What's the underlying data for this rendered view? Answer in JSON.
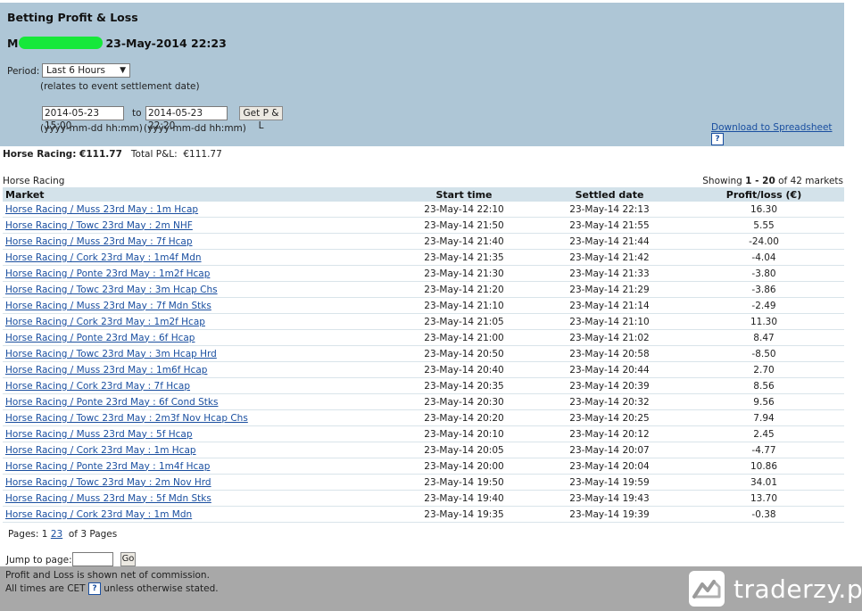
{
  "header": {
    "title": "Betting Profit & Loss",
    "user_initial": "M",
    "datetime": "23-May-2014 22:23",
    "period_label": "Period:",
    "period_value": "Last 6 Hours",
    "period_note": "(relates to event settlement date)",
    "from_date": "2014-05-23 15:00",
    "to_label": "to",
    "to_date": "2014-05-23 22:20",
    "get_button": "Get P & L",
    "format_hint_from": "(yyyy-mm-dd hh:mm)",
    "format_hint_to": "(yyyy-mm-dd hh:mm)",
    "download_link": "Download to Spreadsheet",
    "help_glyph": "?"
  },
  "summary": {
    "category_label": "Horse Racing: €111.77",
    "total_label": "Total P&L:",
    "total_value": "€111.77"
  },
  "section": {
    "name": "Horse Racing",
    "showing_prefix": "Showing",
    "showing_range": "1 - 20",
    "showing_suffix": "of 42 markets"
  },
  "table": {
    "headers": [
      "Market",
      "Start time",
      "Settled date",
      "Profit/loss (€)"
    ],
    "rows": [
      {
        "market": "Horse Racing / Muss 23rd May : 1m Hcap",
        "start": "23-May-14 22:10",
        "settled": "23-May-14 22:13",
        "pl": "16.30"
      },
      {
        "market": "Horse Racing / Towc 23rd May : 2m NHF",
        "start": "23-May-14 21:50",
        "settled": "23-May-14 21:55",
        "pl": "5.55"
      },
      {
        "market": "Horse Racing / Muss 23rd May : 7f Hcap",
        "start": "23-May-14 21:40",
        "settled": "23-May-14 21:44",
        "pl": "-24.00"
      },
      {
        "market": "Horse Racing / Cork 23rd May : 1m4f Mdn",
        "start": "23-May-14 21:35",
        "settled": "23-May-14 21:42",
        "pl": "-4.04"
      },
      {
        "market": "Horse Racing / Ponte 23rd May : 1m2f Hcap",
        "start": "23-May-14 21:30",
        "settled": "23-May-14 21:33",
        "pl": "-3.80"
      },
      {
        "market": "Horse Racing / Towc 23rd May : 3m Hcap Chs",
        "start": "23-May-14 21:20",
        "settled": "23-May-14 21:29",
        "pl": "-3.86"
      },
      {
        "market": "Horse Racing / Muss 23rd May : 7f Mdn Stks",
        "start": "23-May-14 21:10",
        "settled": "23-May-14 21:14",
        "pl": "-2.49"
      },
      {
        "market": "Horse Racing / Cork 23rd May : 1m2f Hcap",
        "start": "23-May-14 21:05",
        "settled": "23-May-14 21:10",
        "pl": "11.30"
      },
      {
        "market": "Horse Racing / Ponte 23rd May : 6f Hcap",
        "start": "23-May-14 21:00",
        "settled": "23-May-14 21:02",
        "pl": "8.47"
      },
      {
        "market": "Horse Racing / Towc 23rd May : 3m Hcap Hrd",
        "start": "23-May-14 20:50",
        "settled": "23-May-14 20:58",
        "pl": "-8.50"
      },
      {
        "market": "Horse Racing / Muss 23rd May : 1m6f Hcap",
        "start": "23-May-14 20:40",
        "settled": "23-May-14 20:44",
        "pl": "2.70"
      },
      {
        "market": "Horse Racing / Cork 23rd May : 7f Hcap",
        "start": "23-May-14 20:35",
        "settled": "23-May-14 20:39",
        "pl": "8.56"
      },
      {
        "market": "Horse Racing / Ponte 23rd May : 6f Cond Stks",
        "start": "23-May-14 20:30",
        "settled": "23-May-14 20:32",
        "pl": "9.56"
      },
      {
        "market": "Horse Racing / Towc 23rd May : 2m3f Nov Hcap Chs",
        "start": "23-May-14 20:20",
        "settled": "23-May-14 20:25",
        "pl": "7.94"
      },
      {
        "market": "Horse Racing / Muss 23rd May : 5f Hcap",
        "start": "23-May-14 20:10",
        "settled": "23-May-14 20:12",
        "pl": "2.45"
      },
      {
        "market": "Horse Racing / Cork 23rd May : 1m Hcap",
        "start": "23-May-14 20:05",
        "settled": "23-May-14 20:07",
        "pl": "-4.77"
      },
      {
        "market": "Horse Racing / Ponte 23rd May : 1m4f Hcap",
        "start": "23-May-14 20:00",
        "settled": "23-May-14 20:04",
        "pl": "10.86"
      },
      {
        "market": "Horse Racing / Towc 23rd May : 2m Nov Hrd",
        "start": "23-May-14 19:50",
        "settled": "23-May-14 19:59",
        "pl": "34.01"
      },
      {
        "market": "Horse Racing / Muss 23rd May : 5f Mdn Stks",
        "start": "23-May-14 19:40",
        "settled": "23-May-14 19:43",
        "pl": "13.70"
      },
      {
        "market": "Horse Racing / Cork 23rd May : 1m Mdn",
        "start": "23-May-14 19:35",
        "settled": "23-May-14 19:39",
        "pl": "-0.38"
      }
    ]
  },
  "pagination": {
    "label": "Pages:",
    "current": "1",
    "links": [
      "2",
      "3"
    ],
    "total": "of 3 Pages",
    "jump_label": "Jump to page:",
    "go_button": "Go"
  },
  "footer": {
    "line1": "Profit and Loss is shown net of commission.",
    "line2_prefix": "All times are CET",
    "line2_suffix": "unless otherwise stated.",
    "help_glyph": "?",
    "watermark": "traderzy.pl"
  },
  "colors": {
    "header_bg": "#aec6d6",
    "table_header_bg": "#d3e2ea",
    "link": "#1a4fa0",
    "redaction": "#16e83a",
    "footer_bg": "#a8a8a8"
  },
  "icons": {
    "select_arrow": "dropdown-arrow-icon",
    "help": "help-icon",
    "logo": "traderzy-logo-icon"
  }
}
